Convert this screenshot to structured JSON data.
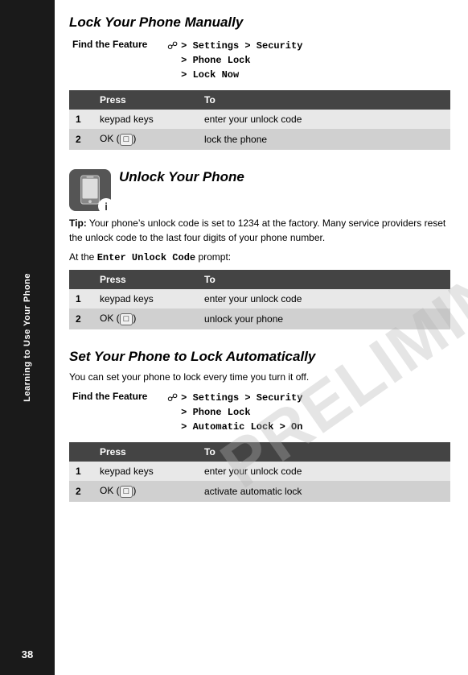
{
  "sidebar": {
    "label": "Learning to Use Your Phone",
    "page_number": "38"
  },
  "section1": {
    "title": "Lock Your Phone Manually",
    "find_feature_label": "Find the Feature",
    "find_feature_path": "> Settings > Security\n> Phone Lock\n> Lock Now",
    "table": {
      "headers": [
        "",
        "Press",
        "To"
      ],
      "rows": [
        {
          "num": "1",
          "press": "keypad keys",
          "to": "enter your unlock code"
        },
        {
          "num": "2",
          "press": "OK (⊡)",
          "to": "lock the phone"
        }
      ]
    }
  },
  "section2": {
    "title": "Unlock Your Phone",
    "tip_prefix": "Tip:",
    "tip_text": " Your phone’s unlock code is set to 1234 at the factory. Many service providers reset the unlock code to the last four digits of your phone number.",
    "prompt_text": "At the ",
    "prompt_mono": "Enter Unlock Code",
    "prompt_suffix": " prompt:",
    "table": {
      "headers": [
        "",
        "Press",
        "To"
      ],
      "rows": [
        {
          "num": "1",
          "press": "keypad keys",
          "to": "enter your unlock code"
        },
        {
          "num": "2",
          "press": "OK (⊡)",
          "to": "unlock your phone"
        }
      ]
    }
  },
  "section3": {
    "title": "Set Your Phone to Lock Automatically",
    "desc": "You can set your phone to lock every time you turn it off.",
    "find_feature_label": "Find the Feature",
    "find_feature_path": "> Settings > Security\n> Phone Lock\n> Automatic Lock > On",
    "table": {
      "headers": [
        "",
        "Press",
        "To"
      ],
      "rows": [
        {
          "num": "1",
          "press": "keypad keys",
          "to": "enter your unlock code"
        },
        {
          "num": "2",
          "press": "OK (⊡)",
          "to": "activate automatic lock"
        }
      ]
    }
  },
  "watermark": "PRELIMINARY"
}
